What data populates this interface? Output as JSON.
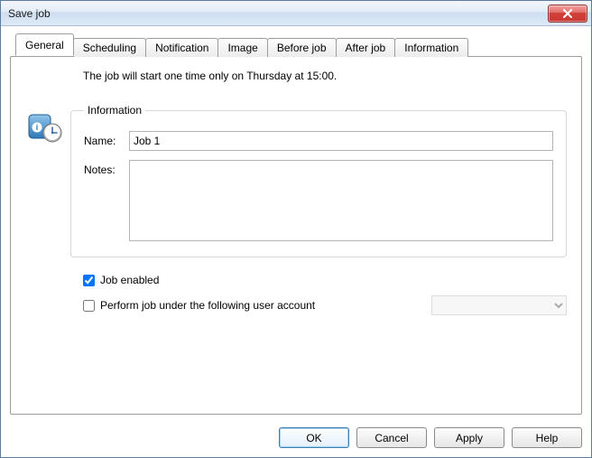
{
  "window": {
    "title": "Save job"
  },
  "tabs": [
    {
      "label": "General"
    },
    {
      "label": "Scheduling"
    },
    {
      "label": "Notification"
    },
    {
      "label": "Image"
    },
    {
      "label": "Before job"
    },
    {
      "label": "After job"
    },
    {
      "label": "Information"
    }
  ],
  "general": {
    "schedule_summary": "The job will start one time only on Thursday at 15:00.",
    "fieldset_title": "Information",
    "name_label": "Name:",
    "name_value": "Job 1",
    "notes_label": "Notes:",
    "notes_value": "",
    "job_enabled_label": "Job enabled",
    "job_enabled_checked": true,
    "run_as_label": "Perform job under the following user account",
    "run_as_checked": false,
    "account_value": ""
  },
  "buttons": {
    "ok": "OK",
    "cancel": "Cancel",
    "apply": "Apply",
    "help": "Help"
  }
}
